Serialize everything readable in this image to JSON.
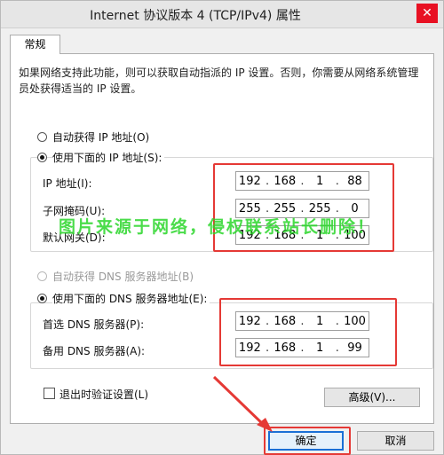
{
  "window": {
    "title": "Internet 协议版本 4 (TCP/IPv4) 属性",
    "close_glyph": "✕"
  },
  "tab": {
    "label": "常规"
  },
  "description": "如果网络支持此功能，则可以获取自动指派的 IP 设置。否则，你需要从网络系统管理员处获得适当的 IP 设置。",
  "ip_section": {
    "auto_label": "自动获得 IP 地址(O)",
    "manual_label": "使用下面的 IP 地址(S):",
    "selected": "manual",
    "fields": [
      {
        "label": "IP 地址(I):",
        "octets": [
          "192",
          "168",
          "1",
          "88"
        ]
      },
      {
        "label": "子网掩码(U):",
        "octets": [
          "255",
          "255",
          "255",
          "0"
        ]
      },
      {
        "label": "默认网关(D):",
        "octets": [
          "192",
          "168",
          "1",
          "100"
        ]
      }
    ]
  },
  "dns_section": {
    "auto_label": "自动获得 DNS 服务器地址(B)",
    "manual_label": "使用下面的 DNS 服务器地址(E):",
    "selected": "manual",
    "fields": [
      {
        "label": "首选 DNS 服务器(P):",
        "octets": [
          "192",
          "168",
          "1",
          "100"
        ]
      },
      {
        "label": "备用 DNS 服务器(A):",
        "octets": [
          "192",
          "168",
          "1",
          "99"
        ]
      }
    ]
  },
  "validate_label": "退出时验证设置(L)",
  "buttons": {
    "advanced": "高级(V)...",
    "ok": "确定",
    "cancel": "取消"
  },
  "watermark": "图片来源于网络，侵权联系站长删除！",
  "colors": {
    "highlight": "#e53935",
    "watermark": "#2bd62b",
    "focus": "#1a6fd6"
  }
}
